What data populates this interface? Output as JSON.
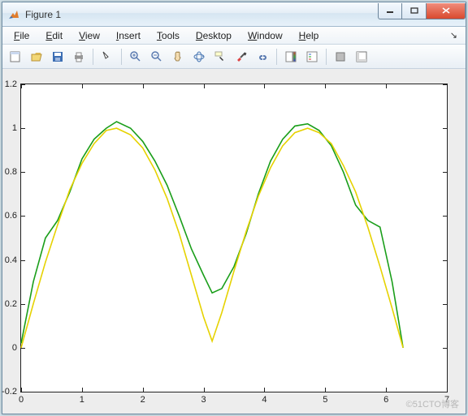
{
  "window": {
    "title": "Figure 1"
  },
  "menu": {
    "items": [
      "File",
      "Edit",
      "View",
      "Insert",
      "Tools",
      "Desktop",
      "Window",
      "Help"
    ]
  },
  "toolbar": {
    "icons": [
      "new",
      "open",
      "save",
      "print",
      "arrow",
      "zoom-in",
      "zoom-out",
      "pan",
      "rotate3d",
      "datatip",
      "brush",
      "link",
      "colorbar",
      "legend",
      "hide",
      "show"
    ]
  },
  "watermark": "©51CTO博客",
  "chart_data": {
    "type": "line",
    "xlabel": "",
    "ylabel": "",
    "xlim": [
      0,
      7
    ],
    "ylim": [
      -0.2,
      1.2
    ],
    "xticks": [
      0,
      1,
      2,
      3,
      4,
      5,
      6,
      7
    ],
    "yticks": [
      -0.2,
      0,
      0.2,
      0.4,
      0.6,
      0.8,
      1,
      1.2
    ],
    "series": [
      {
        "name": "green",
        "color": "#1a9e1a",
        "x": [
          0,
          0.2,
          0.4,
          0.6,
          0.8,
          1.0,
          1.2,
          1.4,
          1.57,
          1.8,
          2.0,
          2.2,
          2.4,
          2.6,
          2.8,
          3.0,
          3.14,
          3.3,
          3.5,
          3.7,
          3.9,
          4.1,
          4.3,
          4.5,
          4.71,
          4.9,
          5.1,
          5.3,
          5.5,
          5.7,
          5.9,
          6.1,
          6.28
        ],
        "y": [
          0.02,
          0.3,
          0.5,
          0.58,
          0.71,
          0.86,
          0.95,
          1.0,
          1.03,
          1.0,
          0.94,
          0.85,
          0.74,
          0.6,
          0.45,
          0.33,
          0.25,
          0.27,
          0.37,
          0.52,
          0.7,
          0.85,
          0.95,
          1.01,
          1.02,
          0.99,
          0.92,
          0.8,
          0.65,
          0.58,
          0.55,
          0.3,
          0.0
        ]
      },
      {
        "name": "yellow",
        "color": "#e6d200",
        "x": [
          0,
          0.2,
          0.4,
          0.6,
          0.8,
          1.0,
          1.2,
          1.4,
          1.57,
          1.8,
          2.0,
          2.2,
          2.4,
          2.6,
          2.8,
          3.0,
          3.14,
          3.3,
          3.5,
          3.7,
          3.9,
          4.1,
          4.3,
          4.5,
          4.71,
          4.9,
          5.1,
          5.3,
          5.5,
          5.7,
          5.9,
          6.1,
          6.28
        ],
        "y": [
          0.0,
          0.2,
          0.39,
          0.56,
          0.72,
          0.84,
          0.93,
          0.99,
          1.0,
          0.97,
          0.91,
          0.81,
          0.68,
          0.52,
          0.33,
          0.14,
          0.03,
          0.16,
          0.35,
          0.53,
          0.69,
          0.82,
          0.92,
          0.98,
          1.0,
          0.98,
          0.93,
          0.83,
          0.71,
          0.55,
          0.37,
          0.18,
          0.0
        ]
      }
    ]
  }
}
